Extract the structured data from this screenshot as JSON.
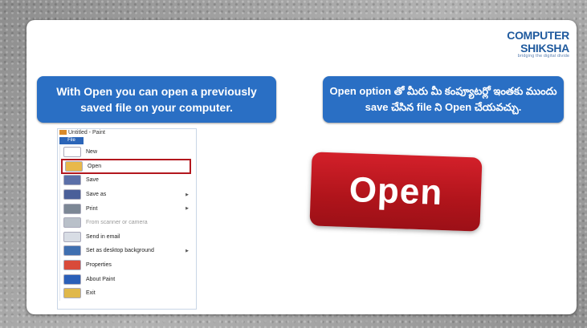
{
  "logo": {
    "name": "COMPUTER SHIKSHA",
    "tagline": "bridging the digital divide"
  },
  "callouts": {
    "english": "With Open you can open a previously saved file on your computer.",
    "telugu": "Open option తో మీరు మీ కంప్యూటర్లో ఇంతకు ముందు save చేసిన file ని Open చేయవచ్చు."
  },
  "paint": {
    "title": "Untitled - Paint",
    "file_tab": "File",
    "menu": [
      {
        "label": "New",
        "icon": "new-file-icon",
        "color": "#ffffff",
        "arrow": false,
        "dim": false
      },
      {
        "label": "Open",
        "icon": "open-folder-icon",
        "color": "#e8b84a",
        "arrow": false,
        "dim": false,
        "highlighted": true
      },
      {
        "label": "Save",
        "icon": "save-icon",
        "color": "#5b6fa8",
        "arrow": false,
        "dim": false
      },
      {
        "label": "Save as",
        "icon": "save-as-icon",
        "color": "#4a5f99",
        "arrow": true,
        "dim": false
      },
      {
        "label": "Print",
        "icon": "print-icon",
        "color": "#7c8795",
        "arrow": true,
        "dim": false
      },
      {
        "label": "From scanner or camera",
        "icon": "scanner-icon",
        "color": "#b9c0c9",
        "arrow": false,
        "dim": true
      },
      {
        "label": "Send in email",
        "icon": "email-icon",
        "color": "#d8dde5",
        "arrow": false,
        "dim": false
      },
      {
        "label": "Set as desktop background",
        "icon": "desktop-background-icon",
        "color": "#3f6fb0",
        "arrow": true,
        "dim": false
      },
      {
        "label": "Properties",
        "icon": "properties-icon",
        "color": "#d94a3a",
        "arrow": false,
        "dim": false
      },
      {
        "label": "About Paint",
        "icon": "about-icon",
        "color": "#2a5fb8",
        "arrow": false,
        "dim": false
      },
      {
        "label": "Exit",
        "icon": "exit-icon",
        "color": "#e0b84a",
        "arrow": false,
        "dim": false
      }
    ]
  },
  "badge": {
    "text": "Open"
  },
  "colors": {
    "callout": "#2a6fc4",
    "badge": "#c4181f",
    "logo": "#1f5a9e"
  }
}
